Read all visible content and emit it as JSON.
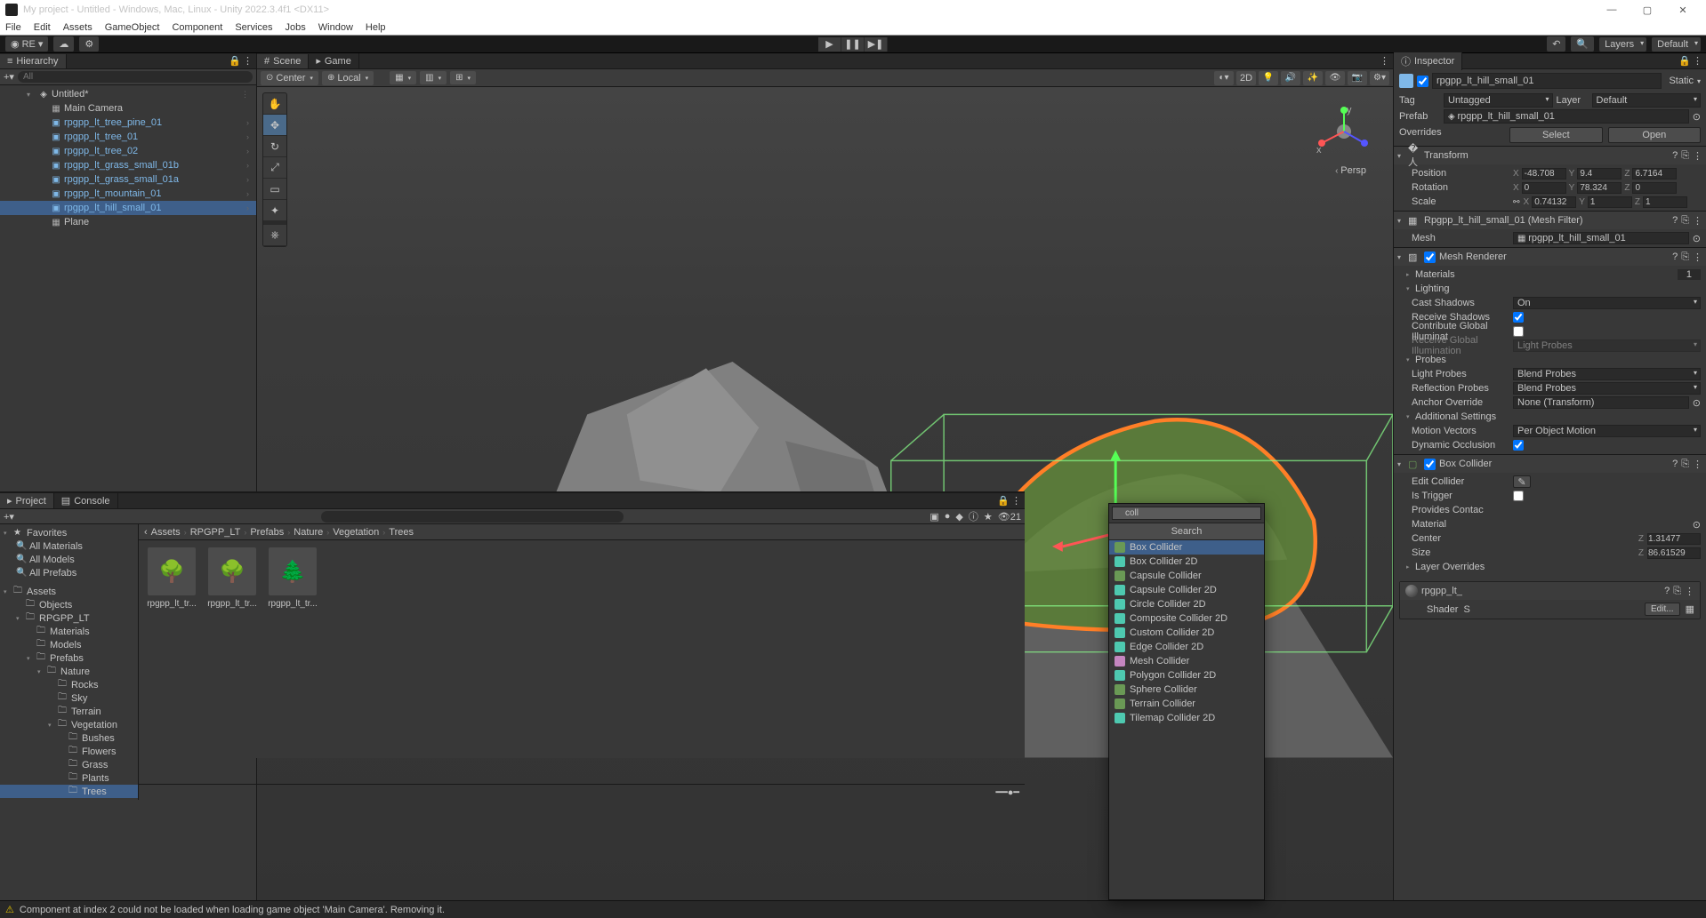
{
  "window": {
    "title": "My project - Untitled - Windows, Mac, Linux - Unity 2022.3.4f1 <DX11>"
  },
  "menu": [
    "File",
    "Edit",
    "Assets",
    "GameObject",
    "Component",
    "Services",
    "Jobs",
    "Window",
    "Help"
  ],
  "toolbar": {
    "account": "RE",
    "layers": "Layers",
    "layout": "Default"
  },
  "hierarchy": {
    "tab": "Hierarchy",
    "search_placeholder": "All",
    "scene": "Untitled*",
    "items": [
      {
        "name": "Main Camera",
        "prefab": false
      },
      {
        "name": "rpgpp_lt_tree_pine_01",
        "prefab": true
      },
      {
        "name": "rpgpp_lt_tree_01",
        "prefab": true
      },
      {
        "name": "rpgpp_lt_tree_02",
        "prefab": true
      },
      {
        "name": "rpgpp_lt_grass_small_01b",
        "prefab": true
      },
      {
        "name": "rpgpp_lt_grass_small_01a",
        "prefab": true
      },
      {
        "name": "rpgpp_lt_mountain_01",
        "prefab": true
      },
      {
        "name": "rpgpp_lt_hill_small_01",
        "prefab": true,
        "selected": true
      },
      {
        "name": "Plane",
        "prefab": false
      }
    ]
  },
  "scene": {
    "tab_scene": "Scene",
    "tab_game": "Game",
    "pivot": "Center",
    "space": "Local",
    "btn_2d": "2D",
    "persp": "Persp",
    "axis_x": "x",
    "axis_y": "y"
  },
  "project": {
    "tab_project": "Project",
    "tab_console": "Console",
    "search_placeholder": "",
    "hidden_count": "21",
    "favorites": "Favorites",
    "fav_items": [
      "All Materials",
      "All Models",
      "All Prefabs"
    ],
    "assets_label": "Assets",
    "tree": [
      {
        "name": "Objects",
        "indent": 1
      },
      {
        "name": "RPGPP_LT",
        "indent": 1,
        "open": true
      },
      {
        "name": "Materials",
        "indent": 2
      },
      {
        "name": "Models",
        "indent": 2
      },
      {
        "name": "Prefabs",
        "indent": 2,
        "open": true
      },
      {
        "name": "Nature",
        "indent": 3,
        "open": true
      },
      {
        "name": "Rocks",
        "indent": 4
      },
      {
        "name": "Sky",
        "indent": 4
      },
      {
        "name": "Terrain",
        "indent": 4
      },
      {
        "name": "Vegetation",
        "indent": 4,
        "open": true
      },
      {
        "name": "Bushes",
        "indent": 5
      },
      {
        "name": "Flowers",
        "indent": 5
      },
      {
        "name": "Grass",
        "indent": 5
      },
      {
        "name": "Plants",
        "indent": 5
      },
      {
        "name": "Trees",
        "indent": 5,
        "selected": true
      }
    ],
    "breadcrumb": [
      "Assets",
      "RPGPP_LT",
      "Prefabs",
      "Nature",
      "Vegetation",
      "Trees"
    ],
    "grid": [
      "rpgpp_lt_tr...",
      "rpgpp_lt_tr...",
      "rpgpp_lt_tr..."
    ]
  },
  "inspector": {
    "tab": "Inspector",
    "name": "rpgpp_lt_hill_small_01",
    "static_label": "Static",
    "tag_label": "Tag",
    "tag": "Untagged",
    "layer_label": "Layer",
    "layer": "Default",
    "prefab_label": "Prefab",
    "prefab_ref": "rpgpp_lt_hill_small_01",
    "overrides": "Overrides",
    "select_btn": "Select",
    "open_btn": "Open",
    "transform": {
      "title": "Transform",
      "position_label": "Position",
      "px": "-48.708",
      "py": "9.4",
      "pz": "6.7164",
      "rotation_label": "Rotation",
      "rx": "0",
      "ry": "78.324",
      "rz": "0",
      "scale_label": "Scale",
      "sx": "0.74132",
      "sy": "1",
      "sz": "1"
    },
    "mesh_filter": {
      "title": "Rpgpp_lt_hill_small_01 (Mesh Filter)",
      "mesh_label": "Mesh",
      "mesh": "rpgpp_lt_hill_small_01"
    },
    "mesh_renderer": {
      "title": "Mesh Renderer",
      "materials_label": "Materials",
      "materials_count": "1",
      "lighting_label": "Lighting",
      "cast_shadows_label": "Cast Shadows",
      "cast_shadows": "On",
      "receive_shadows_label": "Receive Shadows",
      "contribute_gi_label": "Contribute Global Illuminat",
      "receive_gi_label": "Receive Global Illumination",
      "receive_gi": "Light Probes",
      "probes_label": "Probes",
      "light_probes_label": "Light Probes",
      "light_probes": "Blend Probes",
      "reflection_probes_label": "Reflection Probes",
      "reflection_probes": "Blend Probes",
      "anchor_label": "Anchor Override",
      "anchor": "None (Transform)",
      "additional_label": "Additional Settings",
      "motion_label": "Motion Vectors",
      "motion": "Per Object Motion",
      "dynamic_occ_label": "Dynamic Occlusion"
    },
    "box_collider": {
      "title": "Box Collider",
      "edit_label": "Edit Collider",
      "is_trigger_label": "Is Trigger",
      "provides_label": "Provides Contac",
      "material_label": "Material",
      "center_label": "Center",
      "cz": "1.31477",
      "size_label": "Size",
      "sz": "86.61529",
      "layer_ov_label": "Layer Overrides"
    },
    "material": {
      "name": "rpgpp_lt_",
      "shader_label": "Shader",
      "edit_btn": "Edit..."
    }
  },
  "component_search": {
    "query": "coll",
    "title": "Search",
    "items": [
      {
        "name": "Box Collider",
        "selected": true
      },
      {
        "name": "Box Collider 2D"
      },
      {
        "name": "Capsule Collider"
      },
      {
        "name": "Capsule Collider 2D"
      },
      {
        "name": "Circle Collider 2D"
      },
      {
        "name": "Composite Collider 2D"
      },
      {
        "name": "Custom Collider 2D"
      },
      {
        "name": "Edge Collider 2D"
      },
      {
        "name": "Mesh Collider"
      },
      {
        "name": "Polygon Collider 2D"
      },
      {
        "name": "Sphere Collider"
      },
      {
        "name": "Terrain Collider"
      },
      {
        "name": "Tilemap Collider 2D"
      }
    ]
  },
  "status": {
    "message": "Component at index 2 could not be loaded when loading game object 'Main Camera'. Removing it."
  }
}
